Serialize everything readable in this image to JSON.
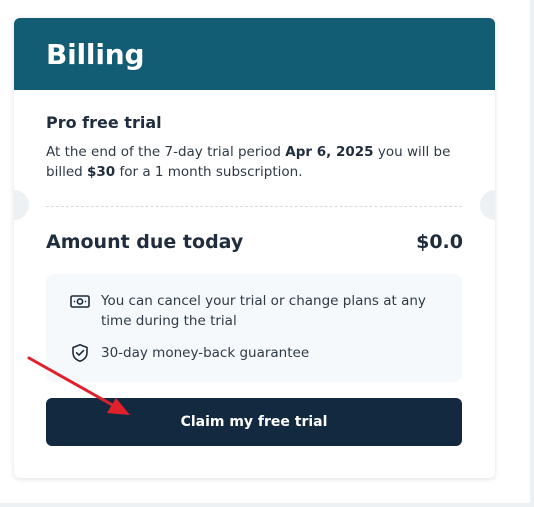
{
  "billing": {
    "title": "Billing",
    "plan_name": "Pro free trial",
    "desc_part1": "At the end of the 7-day trial period ",
    "trial_end_date": "Apr 6, 2025",
    "desc_part2": " you will be billed ",
    "price": "$30",
    "desc_part3": " for a 1 month subscription.",
    "amount_due_label": "Amount due today",
    "amount_due_value": "$0.0",
    "benefits": [
      {
        "icon": "cash-icon",
        "text": "You can cancel your trial or change plans at any time during the trial"
      },
      {
        "icon": "shield-check-icon",
        "text": "30-day money-back guarantee"
      }
    ],
    "cta_label": "Claim my free trial"
  },
  "colors": {
    "header_bg": "#135d74",
    "button_bg": "#13293f",
    "info_box_bg": "#f5f9fc",
    "annotation_arrow": "#e0202a"
  }
}
